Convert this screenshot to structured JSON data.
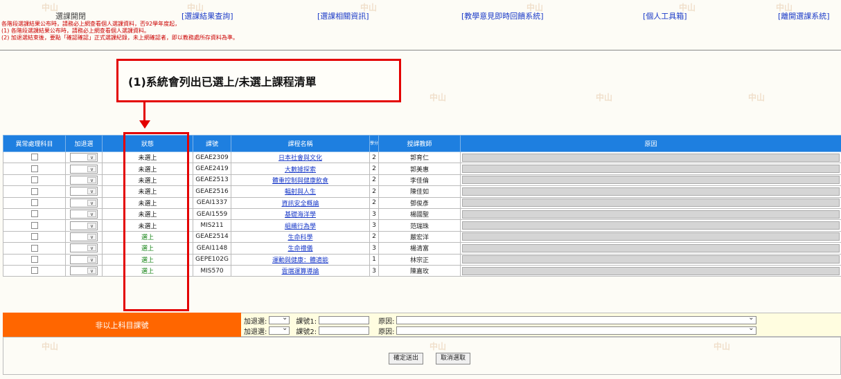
{
  "nav": {
    "items": [
      {
        "label": "選課開閉",
        "style": "plain"
      },
      {
        "label": "[選課結果查詢]",
        "style": "link"
      },
      {
        "label": "[選課相關資訊]",
        "style": "link"
      },
      {
        "label": "[教學意見即時回饋系統]",
        "style": "link"
      },
      {
        "label": "[個人工具箱]",
        "style": "link"
      },
      {
        "label": "[離開選課系統]",
        "style": "link"
      }
    ]
  },
  "notice": {
    "lines": [
      "各階段選課結果公布時，請務必上網查看個人選課資料，否92學年度起，",
      "(1) 各階段選課結果公布時，請務必上網查看個人選課資料。",
      "(2) 加退選結束後，要點「確認確認」正式選課紀錄，未上網確認者，即以教務處所存資料為準。"
    ]
  },
  "callout": {
    "text": "(1)系統會列出已選上/未選上課程清單"
  },
  "table": {
    "headers": {
      "exception": "異常處理科目",
      "add_drop": "加退選",
      "status": "狀態",
      "code": "課號",
      "name": "課程名稱",
      "credit": "學分",
      "teacher": "授課教師",
      "reason": "原因"
    },
    "rows": [
      {
        "status": "未選上",
        "code": "GEAE2309",
        "name": "日本社會與文化",
        "credit": "2",
        "teacher": "郭育仁",
        "ok": false
      },
      {
        "status": "未選上",
        "code": "GEAE2419",
        "name": "大數據探索",
        "credit": "2",
        "teacher": "郭美惠",
        "ok": false
      },
      {
        "status": "未選上",
        "code": "GEAE2513",
        "name": "體重控制與健康飲食",
        "credit": "2",
        "teacher": "李佳倫",
        "ok": false
      },
      {
        "status": "未選上",
        "code": "GEAE2516",
        "name": "輻射與人生",
        "credit": "2",
        "teacher": "陳佳如",
        "ok": false
      },
      {
        "status": "未選上",
        "code": "GEAI1337",
        "name": "資訊安全概論",
        "credit": "2",
        "teacher": "鄧俊彥",
        "ok": false
      },
      {
        "status": "未選上",
        "code": "GEAI1559",
        "name": "基礎海洋學",
        "credit": "3",
        "teacher": "楊國聖",
        "ok": false
      },
      {
        "status": "未選上",
        "code": "MIS211",
        "name": "組織行為學",
        "credit": "3",
        "teacher": "范瑞珠",
        "ok": false
      },
      {
        "status": "選上",
        "code": "GEAE2514",
        "name": "生命科學",
        "credit": "2",
        "teacher": "嚴宏洋",
        "ok": true
      },
      {
        "status": "選上",
        "code": "GEAI1148",
        "name": "生命禮儀",
        "credit": "3",
        "teacher": "楊清富",
        "ok": true
      },
      {
        "status": "選上",
        "code": "GEPE102G",
        "name": "運動與健康：體適能",
        "credit": "1",
        "teacher": "林宗正",
        "ok": true
      },
      {
        "status": "選上",
        "code": "MIS570",
        "name": "雲端運算導論",
        "credit": "3",
        "teacher": "陳嘉玫",
        "ok": true
      }
    ]
  },
  "bottom": {
    "orange_label": "非以上科目課號",
    "add_rows": [
      {
        "sel_label": "加退選:",
        "code_label": "課號1:",
        "reason_label": "原因:"
      },
      {
        "sel_label": "加退選:",
        "code_label": "課號2:",
        "reason_label": "原因:"
      }
    ]
  },
  "buttons": {
    "submit": "確定送出",
    "cancel": "取消選取"
  },
  "colors": {
    "header_blue": "#1e7fe0",
    "orange": "#ff6600",
    "highlight_red": "#e30000",
    "link_blue": "#1a3ac8",
    "selected_green": "#108010"
  }
}
